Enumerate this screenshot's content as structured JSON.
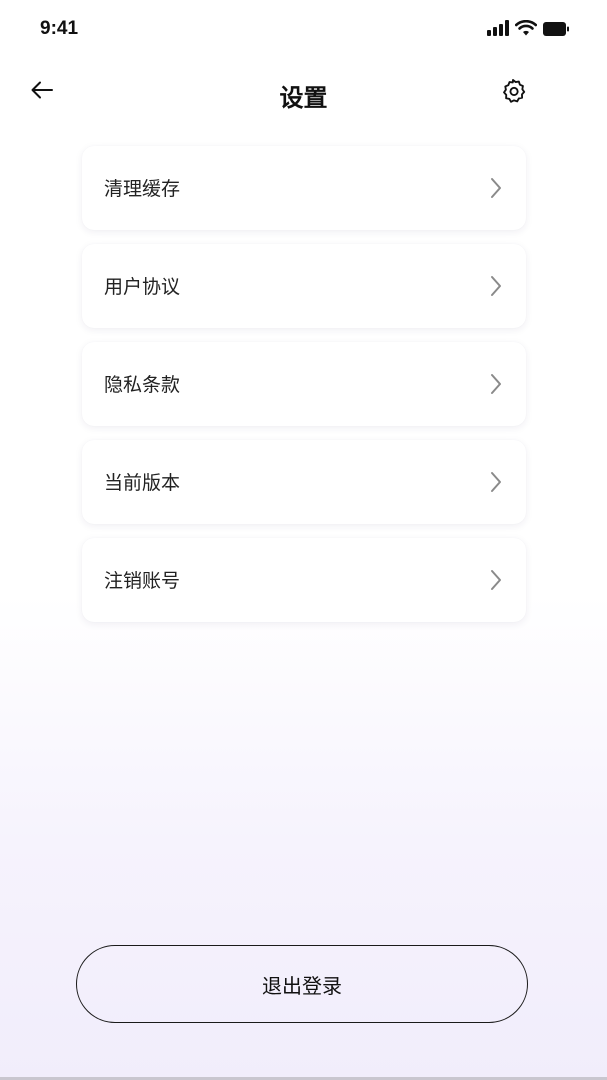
{
  "status_bar": {
    "time": "9:41",
    "icons": [
      "signal-icon",
      "wifi-icon",
      "battery-icon"
    ]
  },
  "nav": {
    "title": "设置",
    "back_icon": "arrow-left-icon",
    "right_icon": "gear-icon"
  },
  "menu": {
    "items": [
      {
        "label": "清理缓存",
        "icon": "chevron-right-icon"
      },
      {
        "label": "用户协议",
        "icon": "chevron-right-icon"
      },
      {
        "label": "隐私条款",
        "icon": "chevron-right-icon"
      },
      {
        "label": "当前版本",
        "icon": "chevron-right-icon"
      },
      {
        "label": "注销账号",
        "icon": "chevron-right-icon"
      }
    ]
  },
  "logout": {
    "label": "退出登录"
  },
  "colors": {
    "text": "#1a1a1a",
    "chevron": "#8a8a8a",
    "background_bottom": "#f1edfb",
    "card": "#ffffff"
  }
}
